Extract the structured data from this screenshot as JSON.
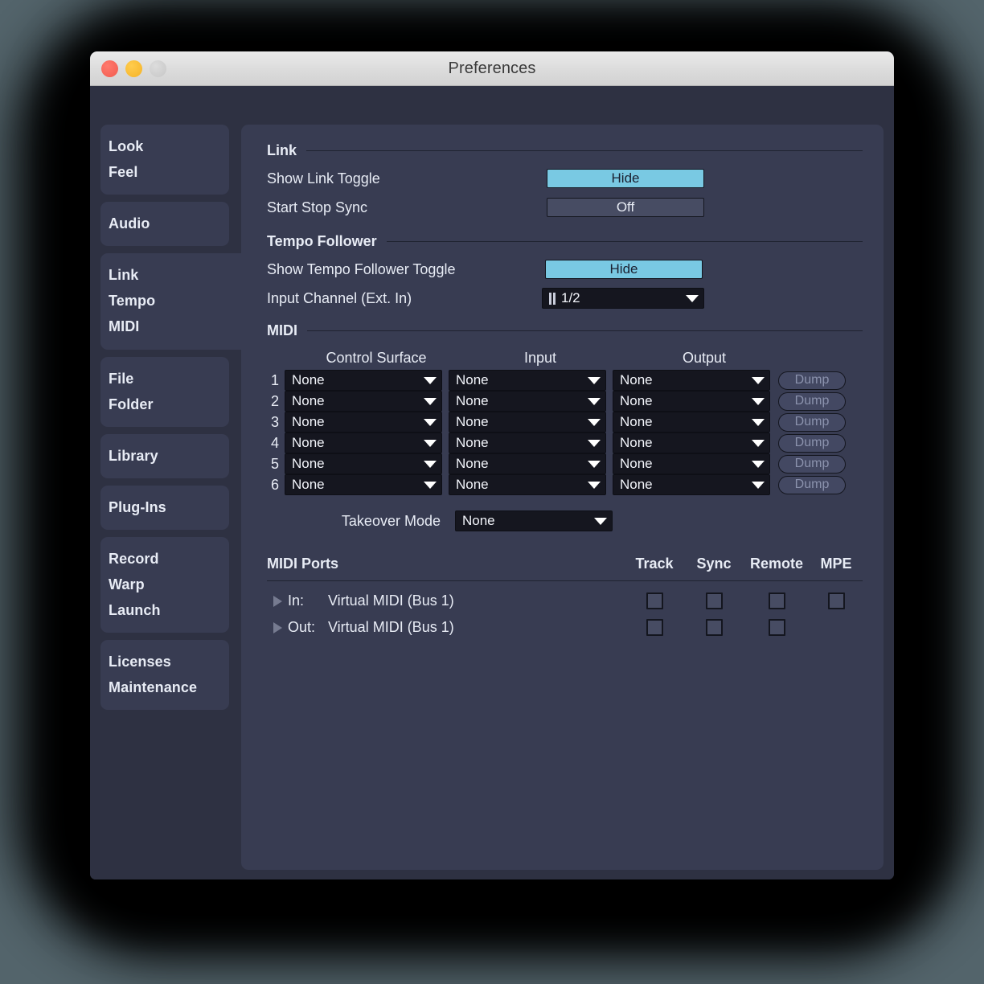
{
  "window": {
    "title": "Preferences",
    "controls": {
      "close": "close",
      "minimize": "minimize",
      "zoom": "zoom"
    },
    "accent_blue": "#79c9e3",
    "panel_bg": "#383c52",
    "window_bg": "#2e3142",
    "field_bg": "#15161f",
    "desktop_bg": "#53646b"
  },
  "sidebar": {
    "groups": [
      {
        "active": false,
        "items": [
          "Look",
          "Feel"
        ]
      },
      {
        "active": false,
        "items": [
          "Audio"
        ]
      },
      {
        "active": true,
        "items": [
          "Link",
          "Tempo",
          "MIDI"
        ]
      },
      {
        "active": false,
        "items": [
          "File",
          "Folder"
        ]
      },
      {
        "active": false,
        "items": [
          "Library"
        ]
      },
      {
        "active": false,
        "items": [
          "Plug-Ins"
        ]
      },
      {
        "active": false,
        "items": [
          "Record",
          "Warp",
          "Launch"
        ]
      },
      {
        "active": false,
        "items": [
          "Licenses",
          "Maintenance"
        ]
      }
    ]
  },
  "link_section": {
    "title": "Link",
    "rows": [
      {
        "label": "Show Link Toggle",
        "value": "Hide",
        "state": "on"
      },
      {
        "label": "Start Stop Sync",
        "value": "Off",
        "state": "off"
      }
    ]
  },
  "tempo_follower_section": {
    "title": "Tempo Follower",
    "toggle_row": {
      "label": "Show Tempo Follower Toggle",
      "value": "Hide",
      "state": "on"
    },
    "input_channel_row": {
      "label": "Input Channel (Ext. In)",
      "value": "1/2",
      "icon": "stereo-pair-icon"
    }
  },
  "midi_section": {
    "title": "MIDI",
    "columns": [
      "Control Surface",
      "Input",
      "Output"
    ],
    "dump_label": "Dump",
    "rows": [
      {
        "index": "1",
        "control_surface": "None",
        "input": "None",
        "output": "None"
      },
      {
        "index": "2",
        "control_surface": "None",
        "input": "None",
        "output": "None"
      },
      {
        "index": "3",
        "control_surface": "None",
        "input": "None",
        "output": "None"
      },
      {
        "index": "4",
        "control_surface": "None",
        "input": "None",
        "output": "None"
      },
      {
        "index": "5",
        "control_surface": "None",
        "input": "None",
        "output": "None"
      },
      {
        "index": "6",
        "control_surface": "None",
        "input": "None",
        "output": "None"
      }
    ],
    "takeover": {
      "label": "Takeover Mode",
      "value": "None"
    }
  },
  "midi_ports_section": {
    "title": "MIDI Ports",
    "columns": [
      "Track",
      "Sync",
      "Remote",
      "MPE"
    ],
    "rows": [
      {
        "expander": "triangle-right-icon",
        "direction": "In:",
        "name": "Virtual MIDI (Bus 1)",
        "track": false,
        "sync": false,
        "remote": false,
        "mpe": false,
        "has_mpe": true
      },
      {
        "expander": "triangle-right-icon",
        "direction": "Out:",
        "name": "Virtual MIDI (Bus 1)",
        "track": false,
        "sync": false,
        "remote": false,
        "mpe": null,
        "has_mpe": false
      }
    ]
  }
}
